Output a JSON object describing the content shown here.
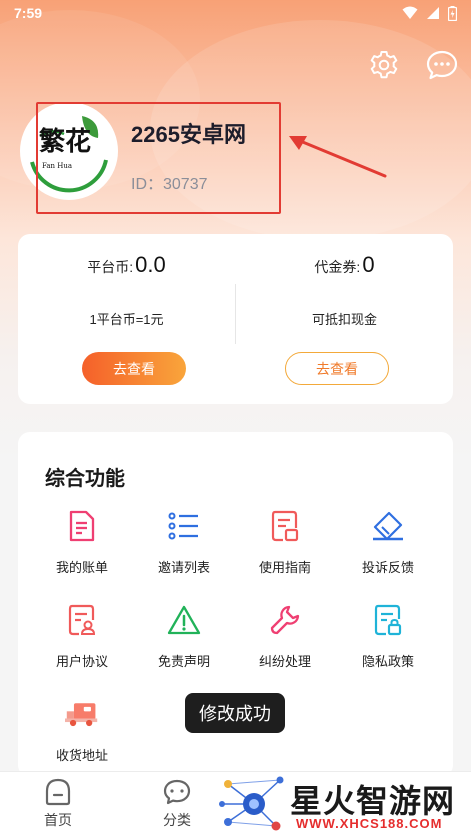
{
  "status_bar": {
    "time": "7:59"
  },
  "header": {
    "settings_icon": "gear-icon",
    "message_icon": "chat-bubble-icon"
  },
  "profile": {
    "avatar_text": "繁花",
    "avatar_sub": "Fan Hua",
    "name": "2265安卓网",
    "id_label": "ID：30737",
    "highlight_color": "#e23b33"
  },
  "wallet": {
    "platform_coin_label": "平台币:",
    "platform_coin_value": "0.0",
    "platform_coin_rate": "1平台币=1元",
    "platform_button": "去查看",
    "voucher_label": "代金券:",
    "voucher_value": "0",
    "voucher_desc": "可抵扣现金",
    "voucher_button": "去查看"
  },
  "functions": {
    "title": "综合功能",
    "items": [
      {
        "label": "我的账单",
        "icon": "bill-icon"
      },
      {
        "label": "邀请列表",
        "icon": "list-icon"
      },
      {
        "label": "使用指南",
        "icon": "guide-icon"
      },
      {
        "label": "投诉反馈",
        "icon": "feedback-icon"
      },
      {
        "label": "用户协议",
        "icon": "agreement-icon"
      },
      {
        "label": "免责声明",
        "icon": "warning-icon"
      },
      {
        "label": "纠纷处理",
        "icon": "wrench-icon"
      },
      {
        "label": "隐私政策",
        "icon": "privacy-icon"
      },
      {
        "label": "收货地址",
        "icon": "delivery-truck-icon"
      }
    ]
  },
  "toast": {
    "message": "修改成功"
  },
  "bottom_nav": {
    "items": [
      {
        "label": "首页",
        "icon": "home-icon"
      },
      {
        "label": "分类",
        "icon": "category-icon"
      }
    ]
  },
  "watermark": {
    "title": "星火智游网",
    "url": "WWW.XHCS188.COM"
  },
  "colors": {
    "accent_orange": "#f5602a",
    "accent_gold": "#f9a53b",
    "icon_pink": "#ef3f72",
    "icon_blue": "#2f6fe0",
    "icon_green": "#21b259",
    "icon_cyan": "#1fb3d8"
  }
}
